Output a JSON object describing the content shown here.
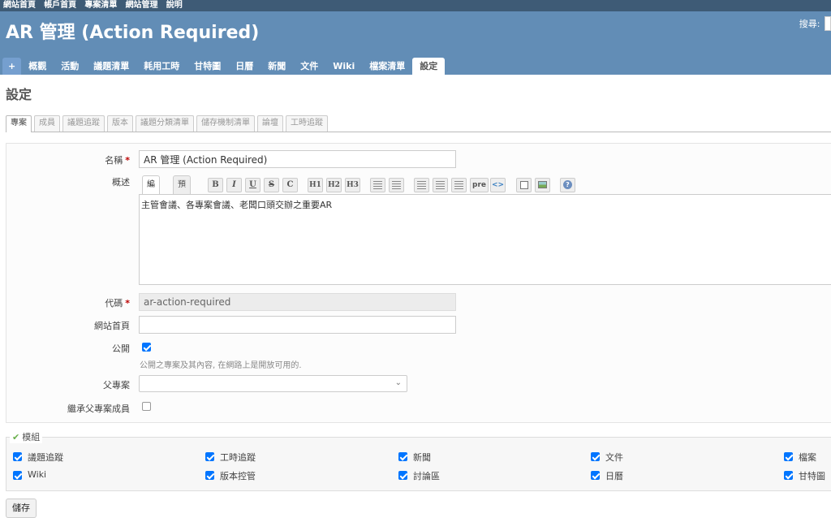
{
  "top_menu": [
    "網站首頁",
    "帳戶首頁",
    "專案清單",
    "網站管理",
    "說明"
  ],
  "header": {
    "title": "AR 管理 (Action Required)",
    "search_label": "搜尋:"
  },
  "main_menu": {
    "new_label": "+",
    "items": [
      "概觀",
      "活動",
      "議題清單",
      "耗用工時",
      "甘特圖",
      "日曆",
      "新聞",
      "文件",
      "Wiki",
      "檔案清單",
      "設定"
    ],
    "selected": "設定"
  },
  "page": {
    "heading": "設定"
  },
  "tabs": [
    "專案",
    "成員",
    "議題追蹤",
    "版本",
    "議題分類清單",
    "儲存機制清單",
    "論壇",
    "工時追蹤"
  ],
  "form": {
    "name_label": "名稱",
    "required_mark": "*",
    "name_value": "AR 管理 (Action Required)",
    "desc_label": "概述",
    "editor_tab_edit": "編輯",
    "editor_tab_preview": "預覽",
    "toolbar": {
      "bold": "B",
      "italic": "I",
      "underline": "U",
      "strike": "S",
      "code": "C",
      "h1": "H1",
      "h2": "H2",
      "h3": "H3",
      "pre": "pre",
      "inline_code": "<>"
    },
    "desc_value": "主管會議、各專案會議、老闆口頭交辦之重要AR",
    "identifier_label": "代碼",
    "identifier_value": "ar-action-required",
    "homepage_label": "網站首頁",
    "homepage_value": "",
    "public_label": "公開",
    "public_checked": true,
    "public_hint": "公開之專案及其內容, 在網路上是開放可用的.",
    "parent_label": "父專案",
    "parent_value": "",
    "inherit_label": "繼承父專案成員",
    "inherit_checked": false
  },
  "modules": {
    "legend": "模組",
    "items": [
      {
        "label": "議題追蹤",
        "checked": true
      },
      {
        "label": "工時追蹤",
        "checked": true
      },
      {
        "label": "新聞",
        "checked": true
      },
      {
        "label": "文件",
        "checked": true
      },
      {
        "label": "檔案",
        "checked": true
      },
      {
        "label": "Wiki",
        "checked": true
      },
      {
        "label": "版本控管",
        "checked": true
      },
      {
        "label": "討論區",
        "checked": true
      },
      {
        "label": "日曆",
        "checked": true
      },
      {
        "label": "甘特圖",
        "checked": true
      }
    ]
  },
  "save_label": "儲存",
  "colors": {
    "top_bar": "#3e5b76",
    "header": "#628db6",
    "checkbox": "#0075ff",
    "required": "#bb0000"
  }
}
